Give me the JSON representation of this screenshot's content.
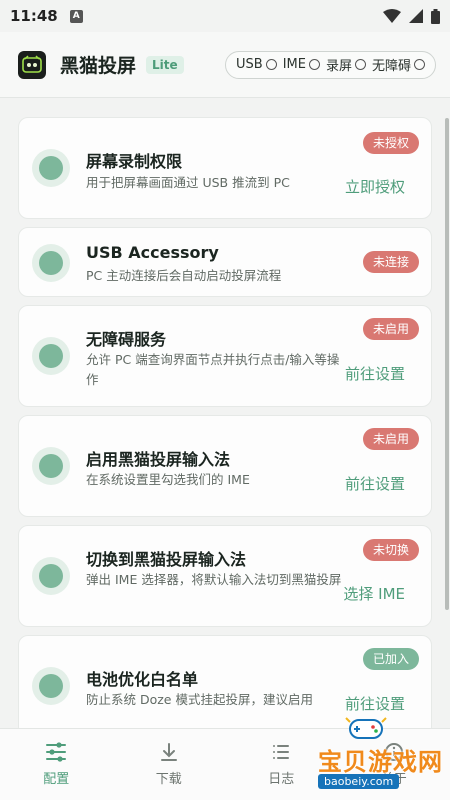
{
  "status_bar": {
    "time": "11:48",
    "notif_letter": "A"
  },
  "header": {
    "title": "黑猫投屏",
    "badge": "Lite",
    "connections": [
      {
        "label": "USB"
      },
      {
        "label": "IME"
      },
      {
        "label": "录屏"
      },
      {
        "label": "无障碍"
      }
    ]
  },
  "cards": [
    {
      "title": "屏幕录制权限",
      "desc": "用于把屏幕画面通过 USB 推流到 PC",
      "badge": "未授权",
      "action": "立即授权"
    },
    {
      "title": "USB Accessory",
      "desc": "PC 主动连接后会自动启动投屏流程",
      "badge": "未连接",
      "action": ""
    },
    {
      "title": "无障碍服务",
      "desc": "允许 PC 端查询界面节点并执行点击/输入等操作",
      "badge": "未启用",
      "action": "前往设置"
    },
    {
      "title": "启用黑猫投屏输入法",
      "desc": "在系统设置里勾选我们的 IME",
      "badge": "未启用",
      "action": "前往设置"
    },
    {
      "title": "切换到黑猫投屏输入法",
      "desc": "弹出 IME 选择器，将默认输入法切到黑猫投屏",
      "badge": "未切换",
      "action": "选择 IME"
    },
    {
      "title": "电池优化白名单",
      "desc": "防止系统 Doze 模式挂起投屏，建议启用",
      "badge": "已加入",
      "action": "前往设置"
    }
  ],
  "nav": [
    {
      "label": "配置",
      "icon": "sliders-icon"
    },
    {
      "label": "下载",
      "icon": "download-icon"
    },
    {
      "label": "日志",
      "icon": "log-icon"
    },
    {
      "label": "关于",
      "icon": "info-icon"
    }
  ],
  "watermark": {
    "text": "宝贝游戏网",
    "url": "baobeiy.com"
  },
  "colors": {
    "accent": "#4f9d7b",
    "warn_badge": "#d97872",
    "ok_badge": "#7db79b"
  }
}
